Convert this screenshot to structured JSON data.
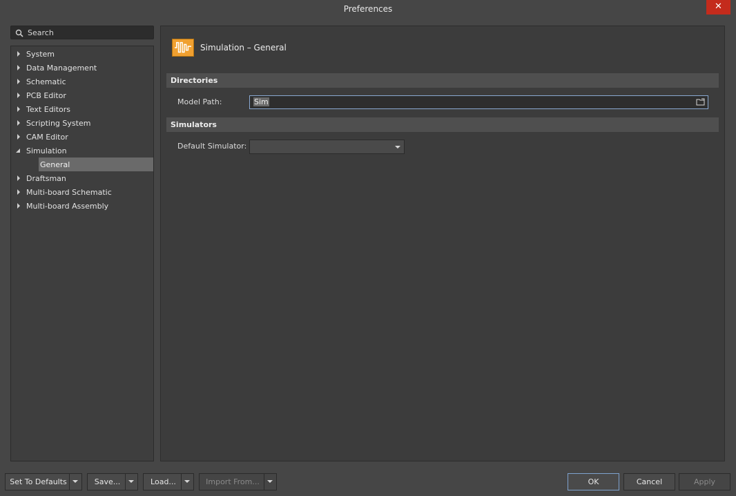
{
  "window": {
    "title": "Preferences",
    "close_glyph": "✕"
  },
  "search": {
    "label": "Search"
  },
  "tree": {
    "items": [
      {
        "label": "System",
        "expanded": false
      },
      {
        "label": "Data Management",
        "expanded": false
      },
      {
        "label": "Schematic",
        "expanded": false
      },
      {
        "label": "PCB Editor",
        "expanded": false
      },
      {
        "label": "Text Editors",
        "expanded": false
      },
      {
        "label": "Scripting System",
        "expanded": false
      },
      {
        "label": "CAM Editor",
        "expanded": false
      },
      {
        "label": "Simulation",
        "expanded": true
      },
      {
        "label": "General",
        "selected": true
      },
      {
        "label": "Draftsman",
        "expanded": false
      },
      {
        "label": "Multi-board Schematic",
        "expanded": false
      },
      {
        "label": "Multi-board Assembly",
        "expanded": false
      }
    ]
  },
  "page": {
    "title": "Simulation – General",
    "icon": "simulation-waveform-icon",
    "sections": {
      "directories": {
        "label": "Directories"
      },
      "simulators": {
        "label": "Simulators"
      }
    },
    "model_path": {
      "label": "Model Path:",
      "value": "Sim"
    },
    "default_simulator": {
      "label": "Default Simulator:",
      "value": ""
    }
  },
  "footer": {
    "set_defaults": "Set To Defaults",
    "save": "Save...",
    "load": "Load...",
    "import_from": "Import From...",
    "ok": "OK",
    "cancel": "Cancel",
    "apply": "Apply"
  },
  "colors": {
    "background": "#464646",
    "panel": "#3c3c3c",
    "accent_icon": "#f0a030",
    "selection": "#6a6a6a",
    "close": "#c42b1c",
    "focus_border": "#8aa9d2"
  }
}
